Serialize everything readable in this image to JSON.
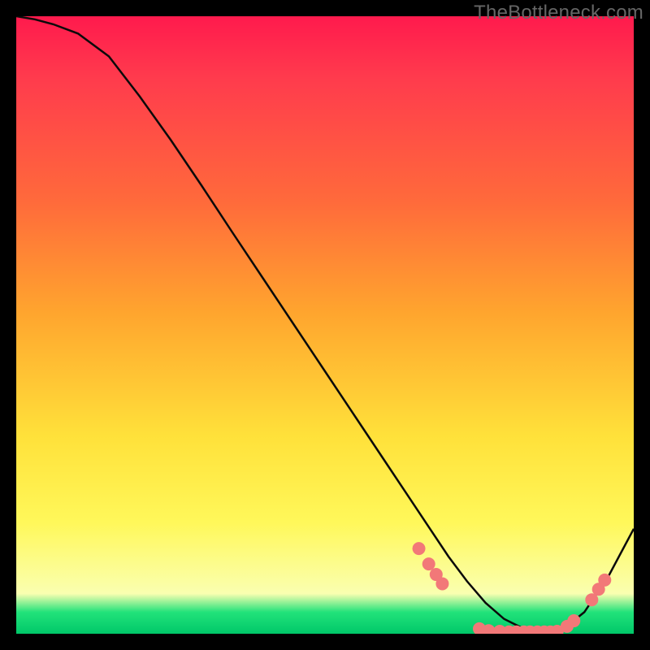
{
  "watermark": "TheBottleneck.com",
  "chart_data": {
    "type": "line",
    "title": "",
    "xlabel": "",
    "ylabel": "",
    "xlim": [
      0,
      100
    ],
    "ylim": [
      0,
      100
    ],
    "series": [
      {
        "name": "curve",
        "x": [
          0,
          3,
          6,
          10,
          15,
          20,
          25,
          30,
          35,
          40,
          45,
          50,
          55,
          60,
          63,
          67,
          70,
          73,
          76,
          79,
          82,
          85,
          88,
          92,
          96,
          100
        ],
        "y": [
          100,
          99.5,
          98.7,
          97.2,
          93.5,
          87,
          80,
          72.6,
          65,
          57.5,
          50,
          42.5,
          35,
          27.5,
          23,
          17,
          12.5,
          8.5,
          5,
          2.4,
          0.9,
          0.3,
          0.3,
          3.5,
          9.5,
          17
        ]
      }
    ],
    "markers": [
      {
        "x": 65.2,
        "y": 13.8
      },
      {
        "x": 66.8,
        "y": 11.3
      },
      {
        "x": 68.0,
        "y": 9.6
      },
      {
        "x": 69.0,
        "y": 8.1
      },
      {
        "x": 75.0,
        "y": 0.8
      },
      {
        "x": 76.5,
        "y": 0.5
      },
      {
        "x": 78.3,
        "y": 0.4
      },
      {
        "x": 79.8,
        "y": 0.3
      },
      {
        "x": 81.0,
        "y": 0.3
      },
      {
        "x": 82.2,
        "y": 0.3
      },
      {
        "x": 83.2,
        "y": 0.3
      },
      {
        "x": 84.4,
        "y": 0.3
      },
      {
        "x": 85.5,
        "y": 0.3
      },
      {
        "x": 86.5,
        "y": 0.3
      },
      {
        "x": 87.6,
        "y": 0.4
      },
      {
        "x": 89.2,
        "y": 1.2
      },
      {
        "x": 90.3,
        "y": 2.1
      },
      {
        "x": 93.2,
        "y": 5.5
      },
      {
        "x": 94.3,
        "y": 7.2
      },
      {
        "x": 95.3,
        "y": 8.7
      }
    ],
    "curve_stroke": "#0a0a0a",
    "marker_color": "#f27878",
    "marker_radius": 8
  }
}
